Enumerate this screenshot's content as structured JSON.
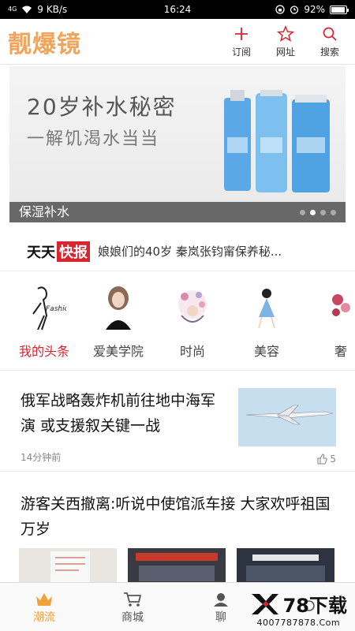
{
  "status_bar": {
    "network": "4G",
    "speed": "9 KB/s",
    "time": "16:24",
    "battery": "92%",
    "battery_level": 0.92
  },
  "header": {
    "logo": "靓爆镜",
    "actions": [
      {
        "label": "订阅",
        "icon": "plus-icon"
      },
      {
        "label": "网址",
        "icon": "star-icon"
      },
      {
        "label": "搜索",
        "icon": "search-icon"
      }
    ]
  },
  "banner": {
    "headline": "20岁补水秘密",
    "subline": "一解饥渴水当当",
    "caption": "保湿补水",
    "dots": 4,
    "active_dot": 2
  },
  "ticker": {
    "tag_part1": "天天",
    "tag_part2": "快报",
    "text": "娘娘们的40岁 秦岚张钧甯保养秘..."
  },
  "categories": [
    {
      "name": "我的头条",
      "active": true
    },
    {
      "name": "爱美学院",
      "active": false
    },
    {
      "name": "时尚",
      "active": false
    },
    {
      "name": "美容",
      "active": false
    },
    {
      "name": "奢",
      "active": false
    }
  ],
  "articles": [
    {
      "title": "俄军战略轰炸机前往地中海军演 或支援叙关键一战",
      "time": "14分钟前",
      "likes": "5"
    },
    {
      "title": "游客关西撤离:听说中使馆派车接 大家欢呼祖国万岁"
    }
  ],
  "bottom_nav": [
    {
      "label": "潮流",
      "icon": "crown-icon",
      "active": true
    },
    {
      "label": "商城",
      "icon": "cart-icon",
      "active": false
    },
    {
      "label": "聊",
      "icon": "chat-icon",
      "active": false
    },
    {
      "label": "",
      "icon": "profile-icon",
      "active": false
    }
  ],
  "watermark": {
    "brand": "78下载",
    "url": "4007787878.Com"
  },
  "colors": {
    "accent": "#f2a45a",
    "highlight_red": "#d9252f",
    "nav_active": "#f2a23a"
  }
}
